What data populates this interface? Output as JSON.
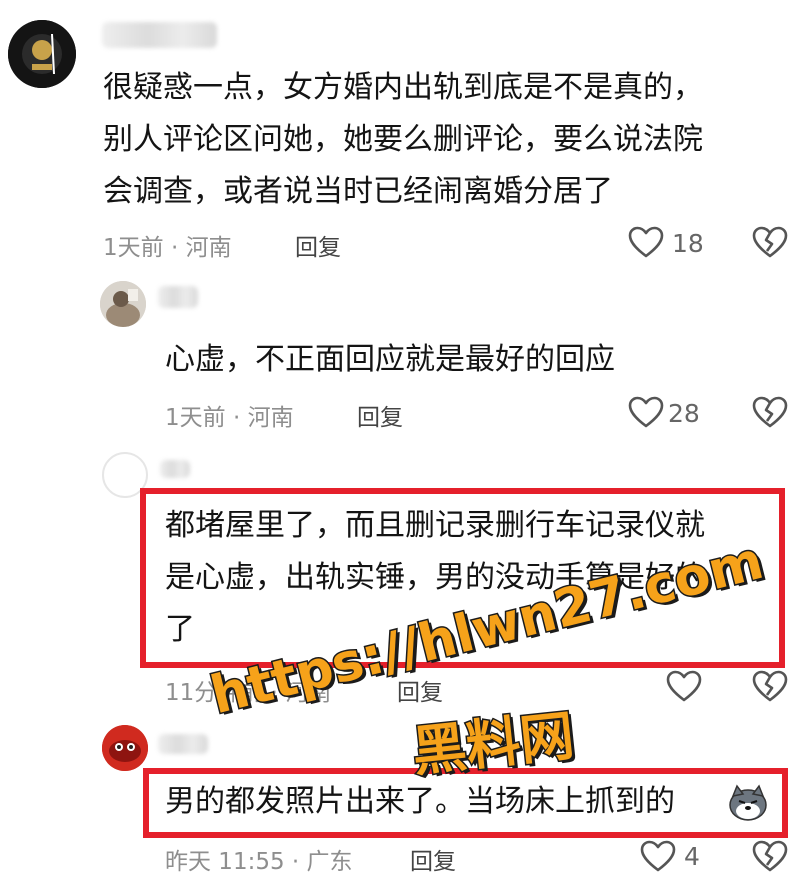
{
  "comments": [
    {
      "text": "很疑惑一点，女方婚内出轨到底是不是真的，\n别人评论区问她，她要么删评论，要么说法院\n会调查，或者说当时已经闹离婚分居了",
      "meta": "1天前 · 河南",
      "reply_label": "回复",
      "likes": "18"
    },
    {
      "text": "心虚，不正面回应就是最好的回应",
      "meta": "1天前 · 河南",
      "reply_label": "回复",
      "likes": "28"
    },
    {
      "text": "都堵屋里了，而且删记录删行车记录仪就\n是心虚，出轨实锤，男的没动手算是好的\n了",
      "meta": "11分钟前 · 河南",
      "reply_label": "回复",
      "likes": ""
    },
    {
      "text": "男的都发照片出来了。当场床上抓到的",
      "meta": "昨天 11:55 · 广东",
      "reply_label": "回复",
      "likes": "4"
    }
  ],
  "watermark": {
    "url": "https://hlwn27.com",
    "name": "黑料网"
  },
  "colors": {
    "highlight": "#e5202b",
    "watermark_fill": "#f6a21a",
    "watermark_stroke": "#1b1b1b",
    "meta_text": "#8e8e8e"
  },
  "icons": {
    "like": "heart-outline-icon",
    "dislike": "broken-heart-icon",
    "emoji": "husky-dog-emoji-icon"
  }
}
